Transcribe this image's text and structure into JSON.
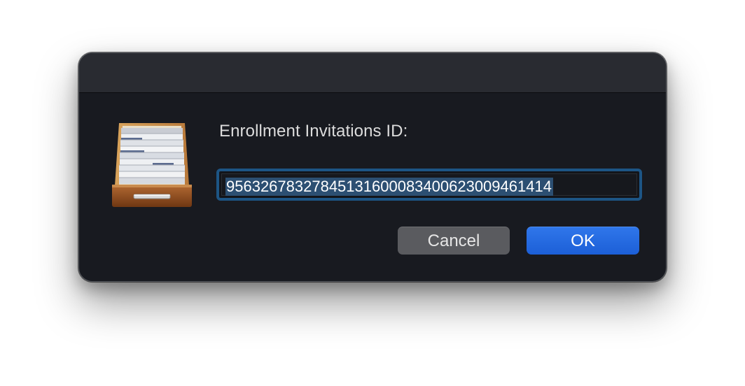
{
  "dialog": {
    "prompt_label": "Enrollment Invitations ID:",
    "input": {
      "value": "9563267832784513160008340062300946141​4",
      "selected": true
    },
    "buttons": {
      "cancel_label": "Cancel",
      "ok_label": "OK"
    },
    "icon": "file-drawer-icon"
  },
  "colors": {
    "dialog_background": "#181a20",
    "titlebar_background": "#292b31",
    "focus_ring": "#1d5585",
    "selection_highlight": "#2c4f72",
    "cancel_button": "#5a5b5f",
    "ok_button": "#1c5fd7"
  }
}
